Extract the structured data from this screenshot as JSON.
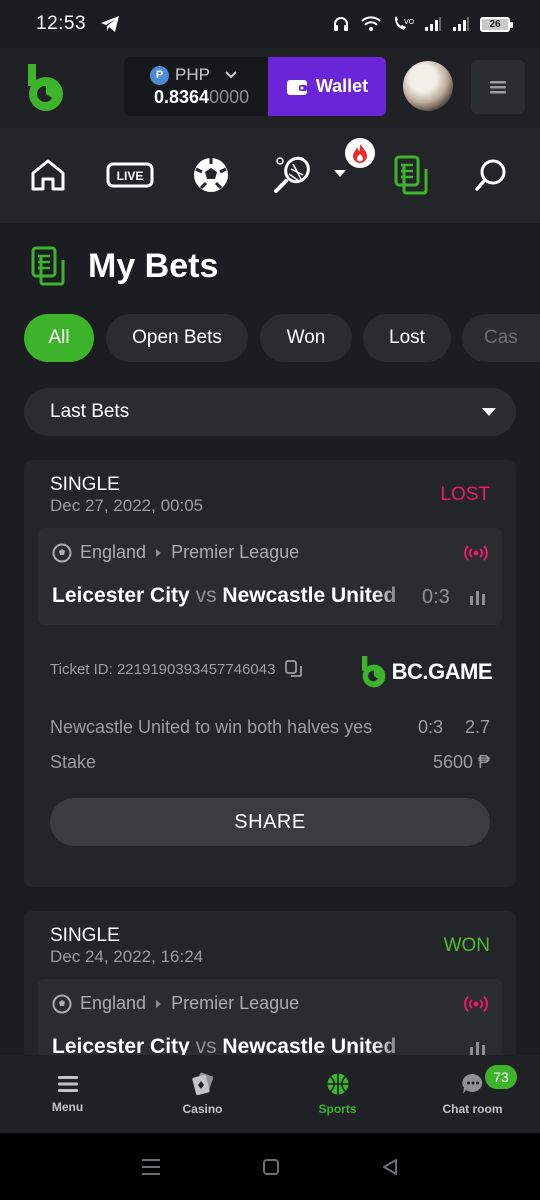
{
  "status_bar": {
    "time": "12:53",
    "battery": "26"
  },
  "header": {
    "currency": "PHP",
    "currency_symbol": "₱",
    "balance_main": "0.8364",
    "balance_dim": "0000",
    "wallet_label": "Wallet"
  },
  "nav": {
    "live_label": "LIVE"
  },
  "page": {
    "title": "My Bets"
  },
  "filter_tabs": [
    "All",
    "Open Bets",
    "Won",
    "Lost",
    "Cas"
  ],
  "dropdown": {
    "selected": "Last Bets"
  },
  "bets": [
    {
      "type": "SINGLE",
      "date": "Dec 27, 2022, 00:05",
      "status": "LOST",
      "country": "England",
      "league": "Premier League",
      "home": "Leicester City",
      "vs": "vs",
      "away": "Newcastle United",
      "score": "0:3",
      "ticket_label": "Ticket ID: 221919039345774604 3",
      "ticket": "Ticket ID: 2219190393457746043",
      "brand": "BC.GAME",
      "selection": "Newcastle United to win both halves yes",
      "selection_score": "0:3",
      "odds": "2.7",
      "stake_label": "Stake",
      "stake_value": "5600 ₱",
      "share_label": "SHARE"
    },
    {
      "type": "SINGLE",
      "date": "Dec 24, 2022, 16:24",
      "status": "WON",
      "country": "England",
      "league": "Premier League",
      "home": "Leicester City",
      "vs": "vs",
      "away": "Newcastle United"
    }
  ],
  "bottom_nav": [
    {
      "label": "Menu"
    },
    {
      "label": "Casino"
    },
    {
      "label": "Sports"
    },
    {
      "label": "Chat room",
      "badge": "73"
    }
  ],
  "colors": {
    "accent_green": "#3db42b",
    "wallet_purple": "#6a25d8",
    "lost_pink": "#ec1b6b",
    "won_green": "#4ebd2f"
  }
}
